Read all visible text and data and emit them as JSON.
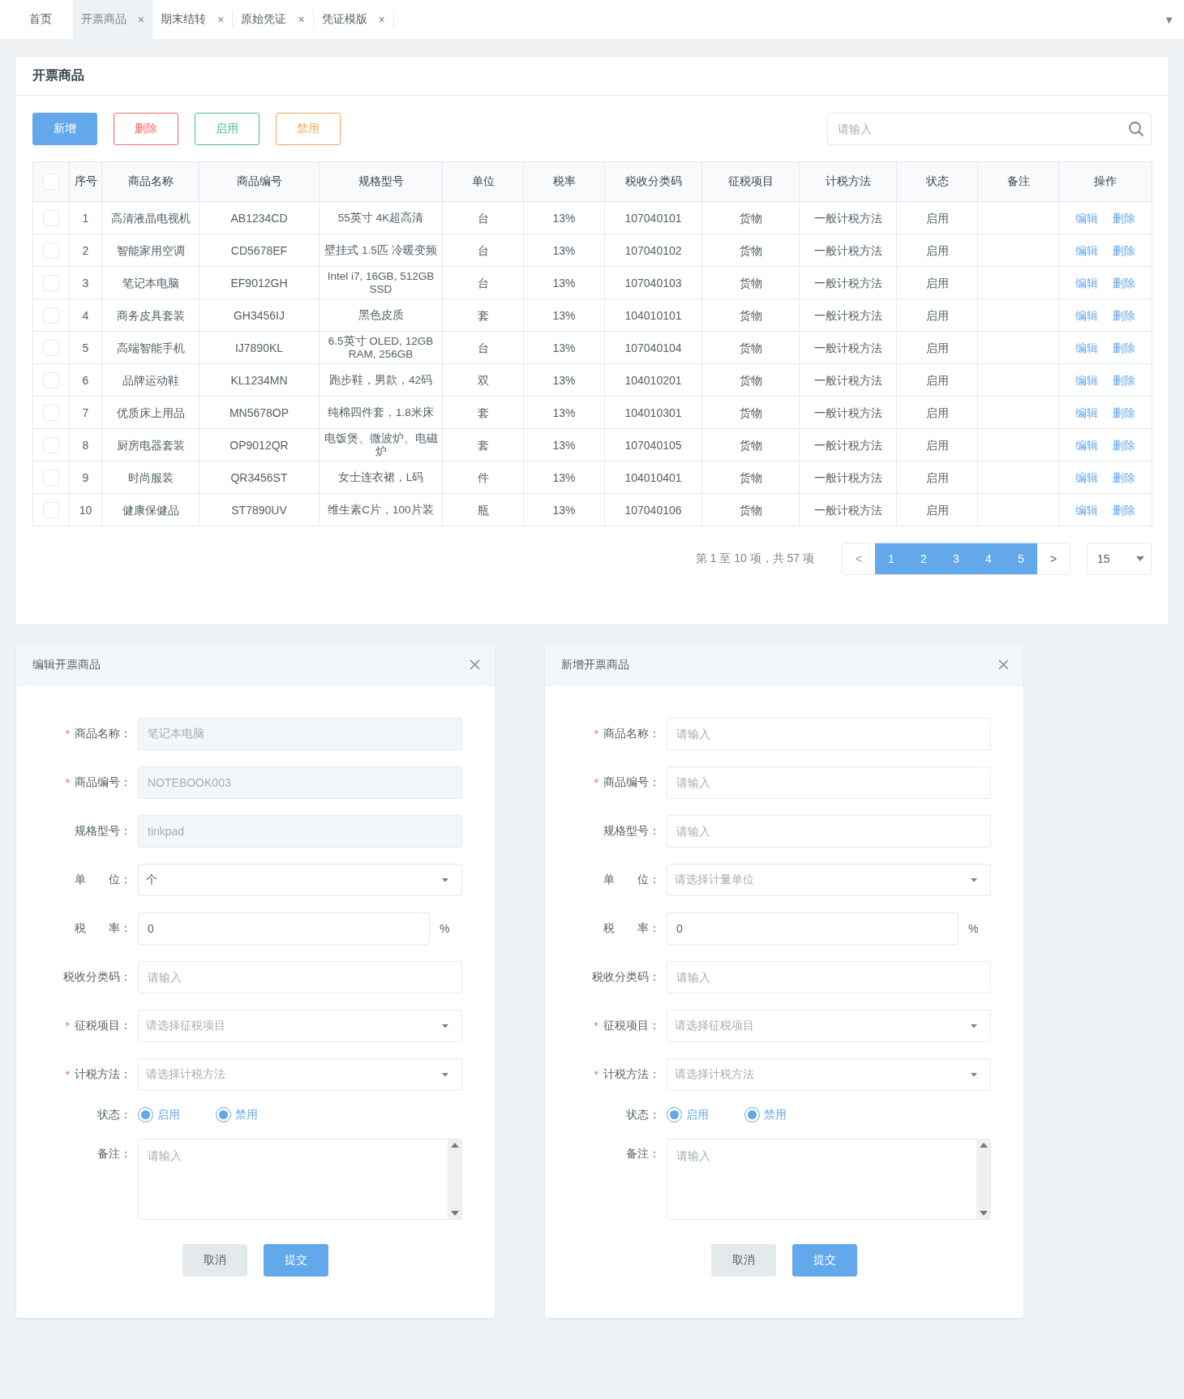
{
  "tabs": [
    {
      "label": "首页",
      "selected": false
    },
    {
      "label": "开票商品",
      "close": "×",
      "selected": true
    },
    {
      "label": "期末结转",
      "close": "×",
      "selected": false
    },
    {
      "label": "原始凭证",
      "close": "×",
      "selected": false
    },
    {
      "label": "凭证模版",
      "close": "×",
      "selected": false
    }
  ],
  "tab_menu": "▼",
  "card": {
    "title": "开票商品",
    "toolbar": [
      {
        "label": "新增",
        "kind": "primary"
      },
      {
        "label": "删除",
        "kind": "danger"
      },
      {
        "label": "启用",
        "kind": "success"
      },
      {
        "label": "禁用",
        "kind": "warning"
      }
    ],
    "search": {
      "placeholder": "请输入"
    },
    "table": {
      "header_checked": false,
      "columns": [
        "序号",
        "商品名称",
        "商品编号",
        "规格型号",
        "单位",
        "税率",
        "税收分类码",
        "征税项目",
        "计税方法",
        "状态",
        "备注",
        "操作"
      ],
      "rows": [
        {
          "checked": false,
          "cells": [
            "1",
            "高清液晶电视机",
            "AB1234CD",
            "55英寸 4K超高清",
            "台",
            "13%",
            "107040101",
            "货物",
            "一般计税方法",
            "启用",
            ""
          ],
          "actions": [
            "编辑",
            "删除"
          ]
        },
        {
          "checked": false,
          "cells": [
            "2",
            "智能家用空调",
            "CD5678EF",
            "壁挂式 1.5匹 冷暖变频",
            "台",
            "13%",
            "107040102",
            "货物",
            "一般计税方法",
            "启用",
            ""
          ],
          "actions": [
            "编辑",
            "删除"
          ]
        },
        {
          "checked": false,
          "cells": [
            "3",
            "笔记本电脑",
            "EF9012GH",
            "Intel i7, 16GB, 512GB SSD",
            "台",
            "13%",
            "107040103",
            "货物",
            "一般计税方法",
            "启用",
            ""
          ],
          "actions": [
            "编辑",
            "删除"
          ]
        },
        {
          "checked": false,
          "cells": [
            "4",
            "商务皮具套装",
            "GH3456IJ",
            "黑色皮质",
            "套",
            "13%",
            "104010101",
            "货物",
            "一般计税方法",
            "启用",
            ""
          ],
          "actions": [
            "编辑",
            "删除"
          ]
        },
        {
          "checked": false,
          "cells": [
            "5",
            "高端智能手机",
            "IJ7890KL",
            "6.5英寸 OLED, 12GB RAM, 256GB",
            "台",
            "13%",
            "107040104",
            "货物",
            "一般计税方法",
            "启用",
            ""
          ],
          "actions": [
            "编辑",
            "删除"
          ]
        },
        {
          "checked": false,
          "cells": [
            "6",
            "品牌运动鞋",
            "KL1234MN",
            "跑步鞋，男款，42码",
            "双",
            "13%",
            "104010201",
            "货物",
            "一般计税方法",
            "启用",
            ""
          ],
          "actions": [
            "编辑",
            "删除"
          ]
        },
        {
          "checked": false,
          "cells": [
            "7",
            "优质床上用品",
            "MN5678OP",
            "纯棉四件套，1.8米床",
            "套",
            "13%",
            "104010301",
            "货物",
            "一般计税方法",
            "启用",
            ""
          ],
          "actions": [
            "编辑",
            "删除"
          ]
        },
        {
          "checked": false,
          "cells": [
            "8",
            "厨房电器套装",
            "OP9012QR",
            "电饭煲、微波炉、电磁炉",
            "套",
            "13%",
            "107040105",
            "货物",
            "一般计税方法",
            "启用",
            ""
          ],
          "actions": [
            "编辑",
            "删除"
          ]
        },
        {
          "checked": false,
          "cells": [
            "9",
            "时尚服装",
            "QR3456ST",
            "女士连衣裙，L码",
            "件",
            "13%",
            "104010401",
            "货物",
            "一般计税方法",
            "启用",
            ""
          ],
          "actions": [
            "编辑",
            "删除"
          ]
        },
        {
          "checked": false,
          "cells": [
            "10",
            "健康保健品",
            "ST7890UV",
            "维生素C片，100片装",
            "瓶",
            "13%",
            "107040106",
            "货物",
            "一般计税方法",
            "启用",
            ""
          ],
          "actions": [
            "编辑",
            "删除"
          ]
        }
      ]
    },
    "pagination": {
      "summary": "第 1 至 10 项，共 57 项",
      "prev": "<",
      "next": ">",
      "pages": [
        {
          "label": "1",
          "selected": true
        },
        {
          "label": "2",
          "selected": true
        },
        {
          "label": "3",
          "selected": true
        },
        {
          "label": "4",
          "selected": true
        },
        {
          "label": "5",
          "selected": true
        }
      ],
      "page_size": "15"
    }
  },
  "dialogs": [
    {
      "title": "编辑开票商品",
      "fields": [
        {
          "kind": "text",
          "label": "商品名称：",
          "required_mark": "*",
          "disabled": true,
          "value": "笔记本电脑"
        },
        {
          "kind": "text",
          "label": "商品编号：",
          "required_mark": "*",
          "disabled": true,
          "value": "NOTEBOOK003"
        },
        {
          "kind": "text",
          "label": "规格型号：",
          "disabled": true,
          "value": "tinkpad"
        },
        {
          "kind": "select",
          "label": "单　　位：",
          "value": "个"
        },
        {
          "kind": "suffix",
          "label": "税　　率：",
          "disabled": false,
          "value": "0",
          "suffix": "%"
        },
        {
          "kind": "text",
          "label": "税收分类码：",
          "disabled": false,
          "placeholder": "请输入"
        },
        {
          "kind": "select",
          "label": "征税项目：",
          "required_mark": "*",
          "placeholder": "请选择征税项目"
        },
        {
          "kind": "select",
          "label": "计税方法：",
          "required_mark": "*",
          "placeholder": "请选择计税方法"
        },
        {
          "kind": "radio",
          "label": "状态：",
          "options": [
            {
              "label": "启用",
              "checked": true
            },
            {
              "label": "禁用",
              "checked": true
            }
          ]
        },
        {
          "kind": "textarea",
          "label": "备注：",
          "placeholder": "请输入"
        }
      ],
      "buttons": [
        {
          "label": "取消",
          "kind": "default"
        },
        {
          "label": "提交",
          "kind": "primary"
        }
      ]
    },
    {
      "title": "新增开票商品",
      "fields": [
        {
          "kind": "text",
          "label": "商品名称：",
          "required_mark": "*",
          "disabled": false,
          "placeholder": "请输入"
        },
        {
          "kind": "text",
          "label": "商品编号：",
          "required_mark": "*",
          "disabled": false,
          "placeholder": "请输入"
        },
        {
          "kind": "text",
          "label": "规格型号：",
          "disabled": false,
          "placeholder": "请输入"
        },
        {
          "kind": "select",
          "label": "单　　位：",
          "placeholder": "请选择计量单位"
        },
        {
          "kind": "suffix",
          "label": "税　　率：",
          "disabled": false,
          "value": "0",
          "suffix": "%"
        },
        {
          "kind": "text",
          "label": "税收分类码：",
          "disabled": false,
          "placeholder": "请输入"
        },
        {
          "kind": "select",
          "label": "征税项目：",
          "required_mark": "*",
          "placeholder": "请选择征税项目"
        },
        {
          "kind": "select",
          "label": "计税方法：",
          "required_mark": "*",
          "placeholder": "请选择计税方法"
        },
        {
          "kind": "radio",
          "label": "状态：",
          "options": [
            {
              "label": "启用",
              "checked": true
            },
            {
              "label": "禁用",
              "checked": true
            }
          ]
        },
        {
          "kind": "textarea",
          "label": "备注：",
          "placeholder": "请输入"
        }
      ],
      "buttons": [
        {
          "label": "取消",
          "kind": "default"
        },
        {
          "label": "提交",
          "kind": "primary"
        }
      ]
    }
  ]
}
